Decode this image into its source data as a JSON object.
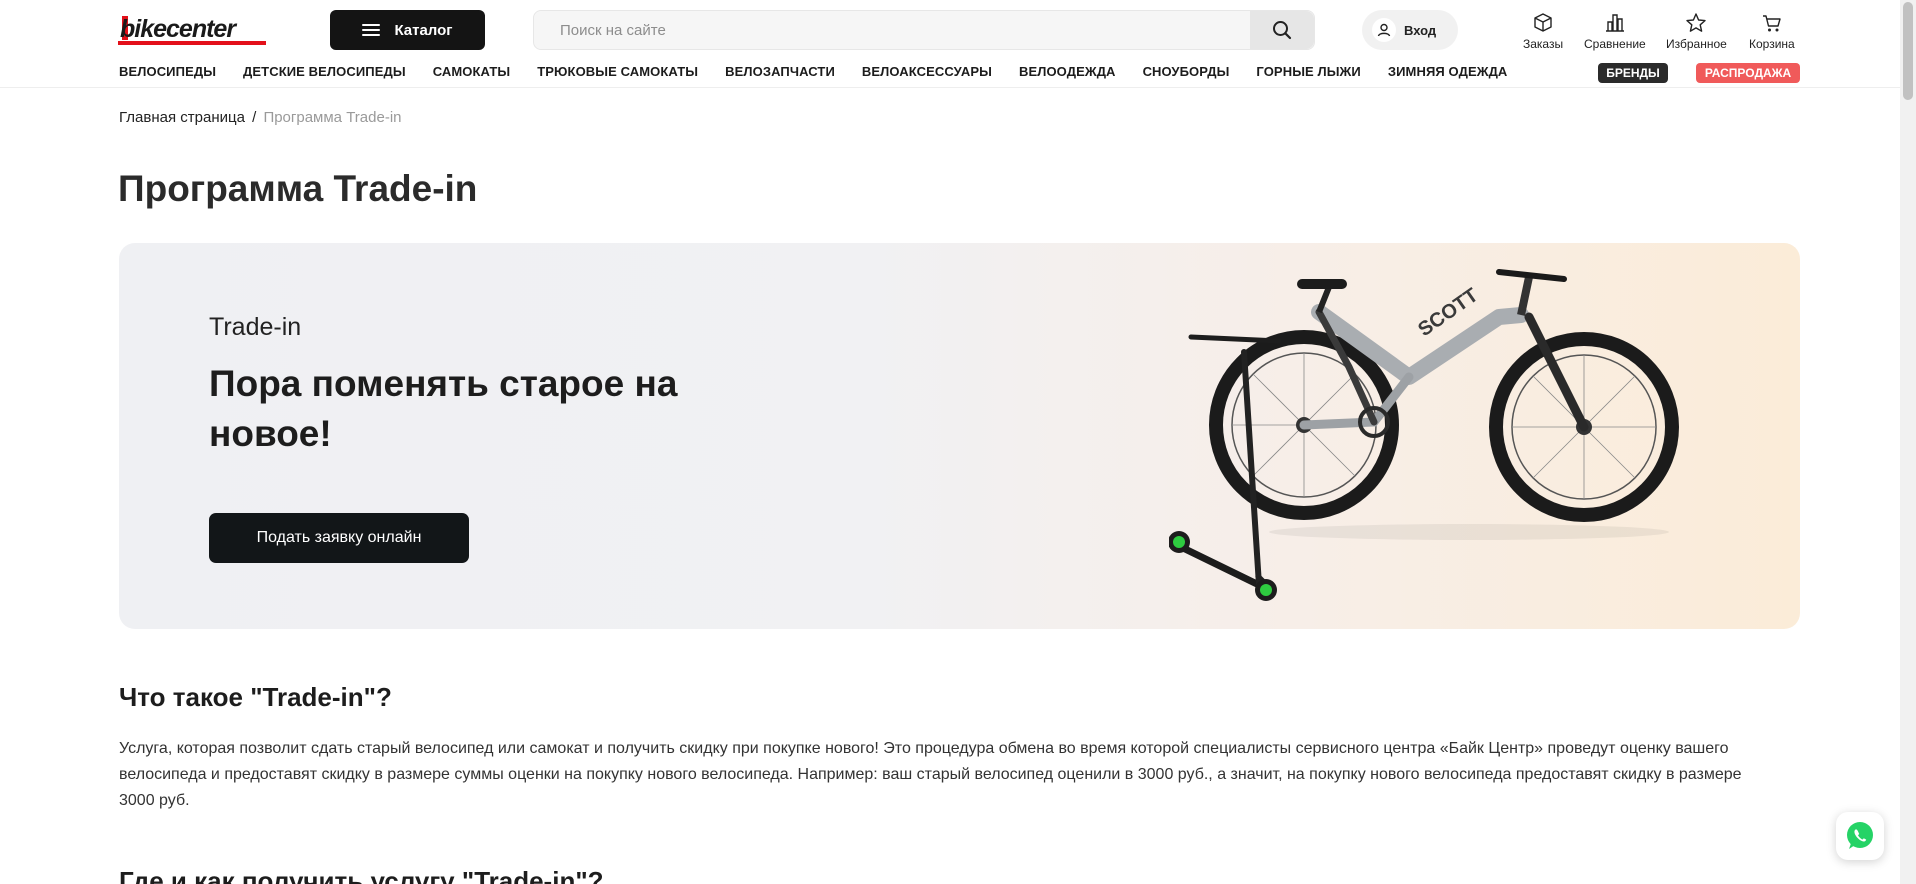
{
  "header": {
    "logo_text": "bikecenter",
    "catalog_label": "Каталог",
    "search_placeholder": "Поиск на сайте",
    "login_label": "Вход",
    "icons": [
      {
        "name": "orders-icon",
        "label": "Заказы"
      },
      {
        "name": "compare-icon",
        "label": "Сравнение"
      },
      {
        "name": "favorites-icon",
        "label": "Избранное"
      },
      {
        "name": "cart-icon",
        "label": "Корзина"
      }
    ]
  },
  "nav": {
    "items": [
      "ВЕЛОСИПЕДЫ",
      "ДЕТСКИЕ ВЕЛОСИПЕДЫ",
      "САМОКАТЫ",
      "ТРЮКОВЫЕ САМОКАТЫ",
      "ВЕЛОЗАПЧАСТИ",
      "ВЕЛОАКСЕССУАРЫ",
      "ВЕЛООДЕЖДА",
      "СНОУБОРДЫ",
      "ГОРНЫЕ ЛЫЖИ",
      "ЗИМНЯЯ ОДЕЖДА"
    ],
    "brands_label": "БРЕНДЫ",
    "sale_label": "РАСПРОДАЖА"
  },
  "breadcrumb": {
    "home": "Главная страница",
    "separator": "/",
    "current": "Программа Trade-in"
  },
  "page_title": "Программа Trade-in",
  "banner": {
    "small_title": "Trade-in",
    "title": "Пора поменять старое на новое!",
    "button_label": "Подать заявку онлайн",
    "bike_brand_text": "SCOTT"
  },
  "section1": {
    "title": "Что такое \"Trade-in\"?",
    "text": "Услуга, которая позволит сдать старый велосипед или самокат и получить скидку при покупке нового! Это процедура обмена во время которой специалисты сервисного центра «Байк Центр» проведут оценку вашего велосипеда и предоставят скидку в размере суммы оценки на покупку нового велосипеда. Например: ваш старый велосипед оценили в 3000 руб., а значит, на покупку нового велосипеда предоставят скидку в размере 3000 руб."
  },
  "section2": {
    "title": "Где и как получить услугу \"Trade-in\"?"
  },
  "colors": {
    "brand_red": "#e3101a",
    "dark": "#141414",
    "sale": "#f05a5a",
    "whatsapp": "#25d366"
  }
}
